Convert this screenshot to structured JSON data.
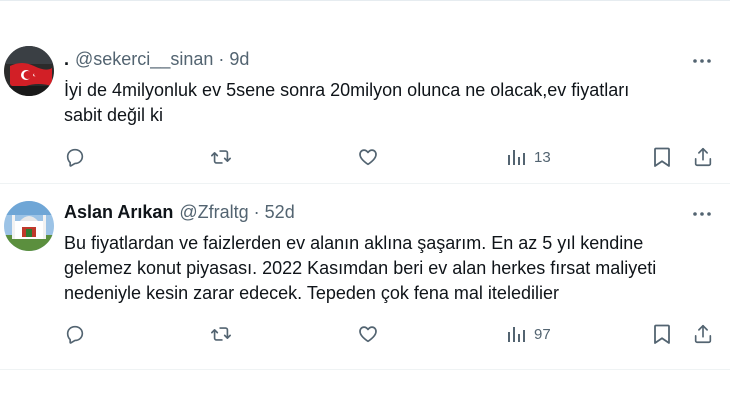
{
  "tweets": [
    {
      "display_name": ".",
      "handle": "@sekerci__sinan",
      "separator": "·",
      "time": "9d",
      "text": "İyi de 4milyonluk ev 5sene sonra 20milyon olunca ne olacak,ev fiyatları\nsabit değil ki",
      "views": "13",
      "avatar_icon": "turkish-flag-avatar"
    },
    {
      "display_name": "Aslan Arıkan",
      "handle": "@Zfraltg",
      "separator": "·",
      "time": "52d",
      "text": "Bu fiyatlardan ve faizlerden ev alanın aklına şaşarım. En az 5 yıl kendine\ngelemez konut piyasası. 2022 Kasımdan beri ev alan herkes fırsat maliyeti\nnedeniyle kesin zarar edecek. Tepeden çok fena mal iteledilier",
      "views": "97",
      "avatar_icon": "mosque-photo-avatar"
    }
  ],
  "icons": {
    "reply": "reply-icon",
    "retweet": "retweet-icon",
    "like": "heart-icon",
    "views": "views-icon",
    "bookmark": "bookmark-icon",
    "share": "share-icon",
    "more": "more-icon"
  },
  "colors": {
    "text_primary": "#0f1419",
    "text_secondary": "#536471",
    "divider": "#eff3f4"
  }
}
